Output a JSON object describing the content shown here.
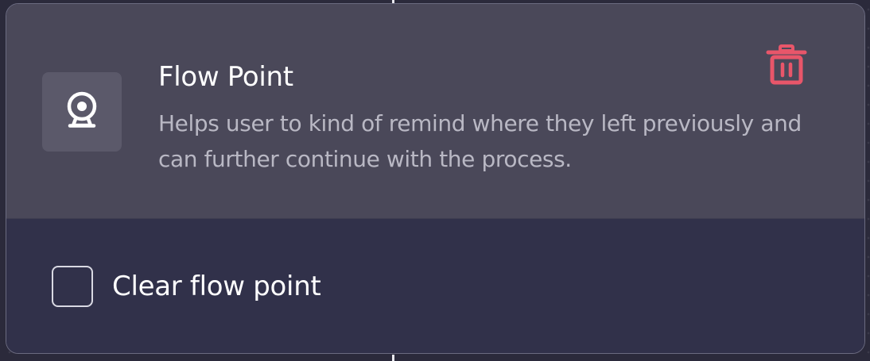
{
  "node": {
    "title": "Flow Point",
    "description": "Helps user to kind of remind where they left previously and can further continue with the process.",
    "icon": "webcam-icon",
    "delete_icon": "trash-icon",
    "option": {
      "label": "Clear flow point",
      "checked": false
    }
  },
  "colors": {
    "header_bg": "#4a4859",
    "footer_bg": "#31314a",
    "delete_accent": "#e8566a",
    "text_primary": "#ffffff",
    "text_secondary": "#b9b8c4"
  }
}
